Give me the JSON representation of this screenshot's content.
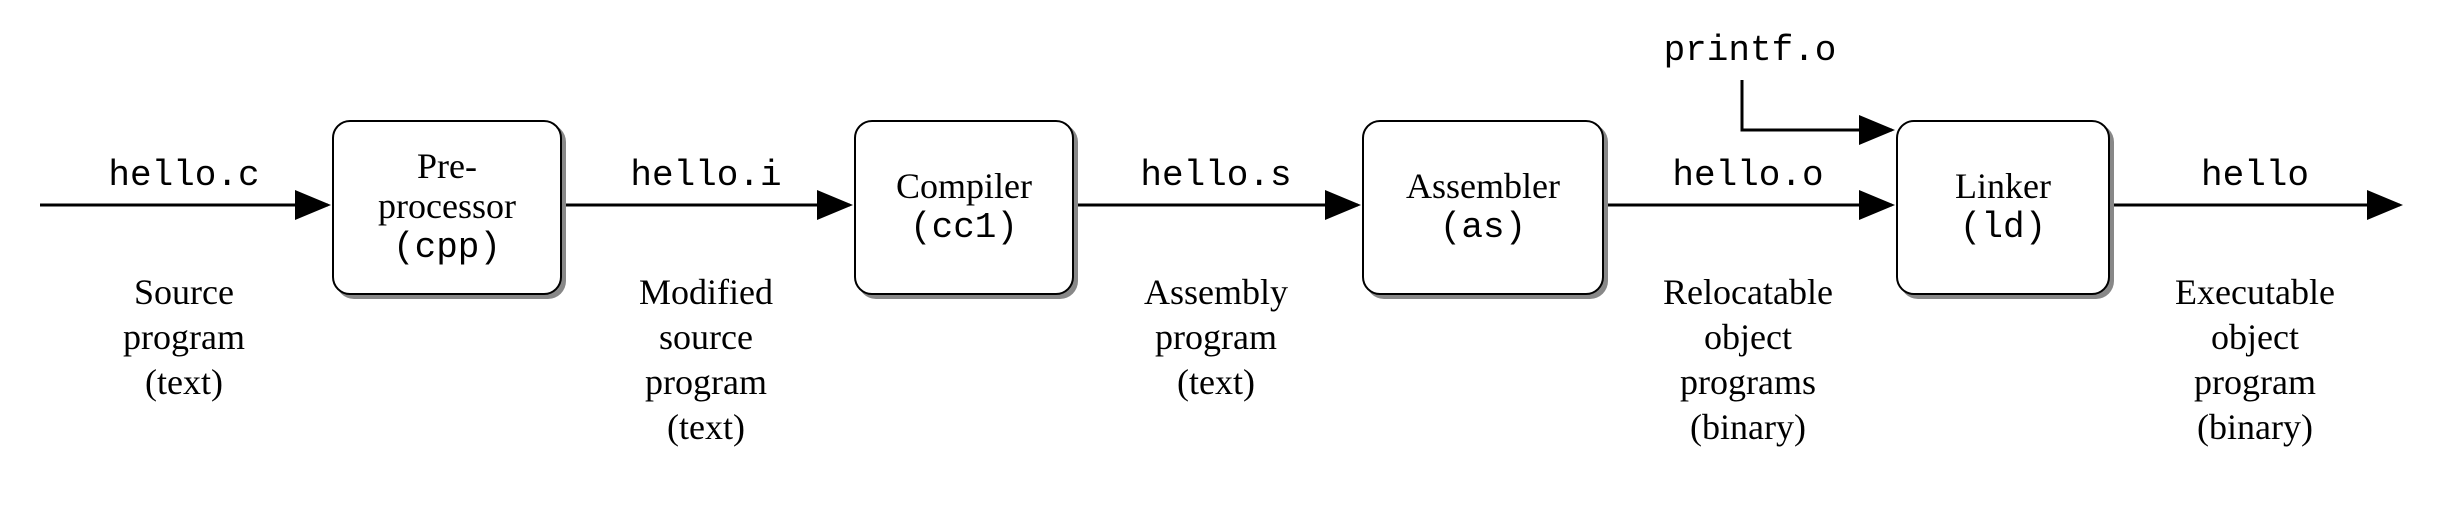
{
  "stages": [
    {
      "title": "Pre-\nprocessor",
      "tool": "(cpp)"
    },
    {
      "title": "Compiler",
      "tool": "(cc1)"
    },
    {
      "title": "Assembler",
      "tool": "(as)"
    },
    {
      "title": "Linker",
      "tool": "(ld)"
    }
  ],
  "arrows": [
    {
      "file": "hello.c",
      "desc": "Source\nprogram\n(text)"
    },
    {
      "file": "hello.i",
      "desc": "Modified\nsource\nprogram\n(text)"
    },
    {
      "file": "hello.s",
      "desc": "Assembly\nprogram\n(text)"
    },
    {
      "file": "hello.o",
      "desc": "Relocatable\nobject\nprograms\n(binary)"
    },
    {
      "file": "hello",
      "desc": "Executable\nobject\nprogram\n(binary)"
    }
  ],
  "externalInput": "printf.o"
}
